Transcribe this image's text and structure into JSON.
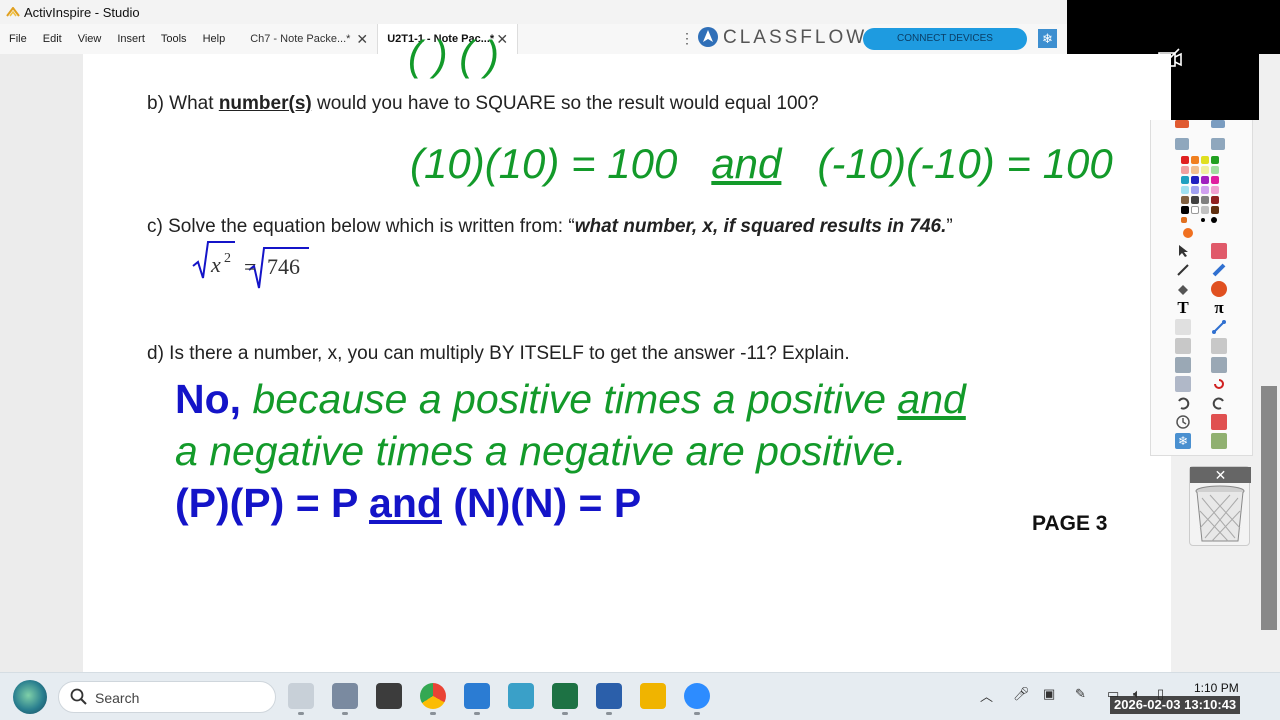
{
  "window": {
    "title": "ActivInspire - Studio"
  },
  "menu": [
    "File",
    "Edit",
    "View",
    "Insert",
    "Tools",
    "Help"
  ],
  "tabs": [
    {
      "label": "Ch7 - Note Packe...*",
      "active": false
    },
    {
      "label": "U2T1-1 - Note Pac...*",
      "active": true
    }
  ],
  "classflow": {
    "brand": "CLASSFLOW",
    "connect_label": "CONNECT DEVICES"
  },
  "page": {
    "question_b": {
      "prefix": "b) What ",
      "emphasis": "number(s)",
      "suffix": " would you have to SQUARE so the result would equal 100?"
    },
    "answer_b": {
      "part1": "(10)(10) = 100",
      "and": "and",
      "part2": "(-10)(-10) = 100"
    },
    "question_c": {
      "prefix": "c) Solve the equation below which is written from: “",
      "emphasis": "what number, x, if squared results in 746.",
      "suffix": "”"
    },
    "equation_c": {
      "lhs": "x",
      "exponent": "2",
      "equals": "=",
      "rhs": "746"
    },
    "question_d": "d) Is there a number, x, you can multiply BY ITSELF to get the answer -11? Explain.",
    "answer_d": {
      "no": "No,",
      "line1": " because a positive times a positive ",
      "line1_and": "and",
      "line2": "a negative times a negative are positive.",
      "line3_a": "(P)(P) = P ",
      "line3_and": "and",
      "line3_b": " (N)(N) = P"
    },
    "page_number": "PAGE 3"
  },
  "taskbar": {
    "search_placeholder": "Search",
    "time": "1:10 PM",
    "timestamp": "2026-02-03 13:10:43"
  },
  "colors": {
    "answer_green": "#139a2a",
    "answer_blue": "#1414c8",
    "classflow_button": "#1e9be0"
  }
}
